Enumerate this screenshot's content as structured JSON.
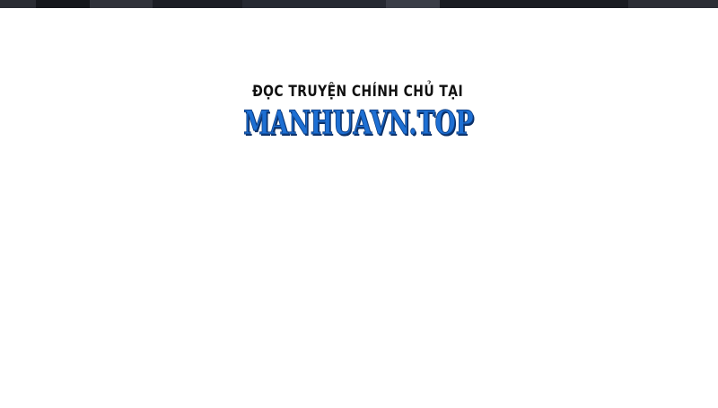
{
  "banner": {
    "tagline": "ĐỌC TRUYỆN CHÍNH CHỦ TẠI",
    "site": "MANHUAVN.TOP"
  },
  "colors": {
    "background": "#ffffff",
    "top_strip": "#1b1d24",
    "logo_fill": "#1d6fd3",
    "logo_outline": "#0d3f86",
    "tagline": "#111111"
  }
}
